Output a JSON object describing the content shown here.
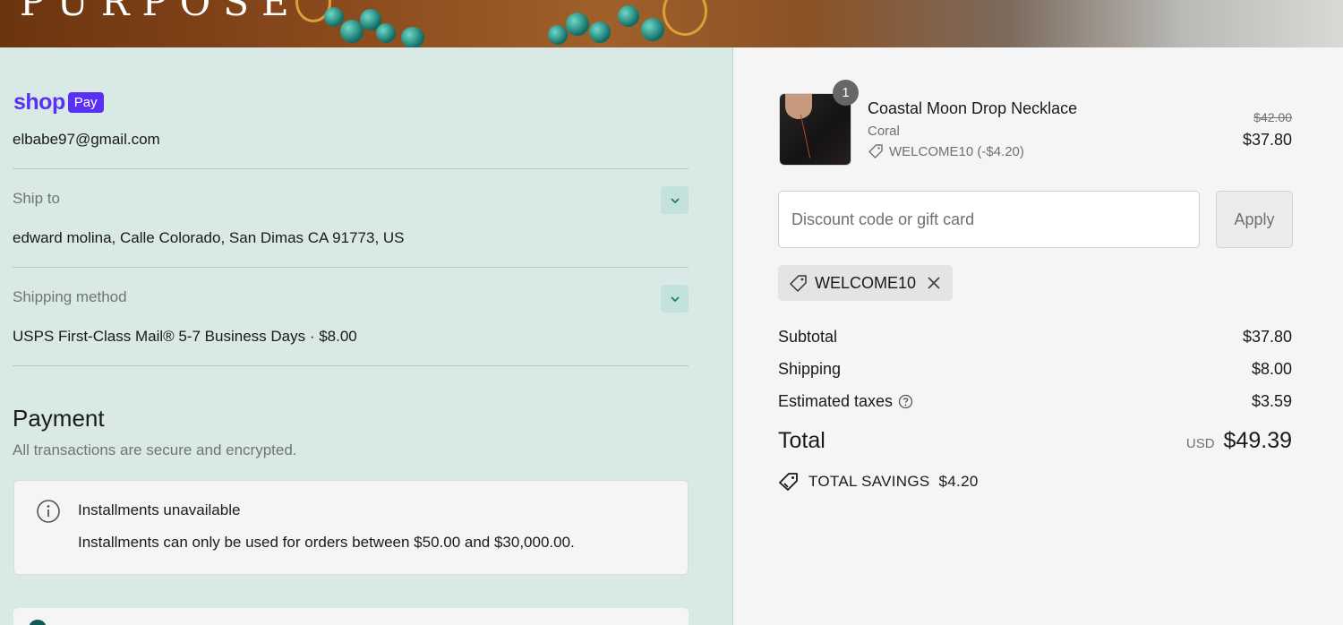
{
  "banner": {
    "brand_text": "PURPOSE"
  },
  "shop_pay": {
    "shop": "shop",
    "pay": "Pay"
  },
  "contact": {
    "email": "elbabe97@gmail.com"
  },
  "ship_to": {
    "label": "Ship to",
    "value": "edward molina, Calle Colorado, San Dimas CA 91773, US"
  },
  "shipping_method": {
    "label": "Shipping method",
    "value": "USPS First-Class Mail® 5-7 Business Days · $8.00"
  },
  "payment": {
    "title": "Payment",
    "subtitle": "All transactions are secure and encrypted.",
    "installments_title": "Installments unavailable",
    "installments_desc": "Installments can only be used for orders between $50.00 and $30,000.00."
  },
  "cart": {
    "item": {
      "quantity": "1",
      "name": "Coastal Moon Drop Necklace",
      "variant": "Coral",
      "discount": "WELCOME10 (-$4.20)",
      "price_original": "$42.00",
      "price_final": "$37.80"
    },
    "discount_placeholder": "Discount code or gift card",
    "apply_label": "Apply",
    "applied_code": "WELCOME10"
  },
  "summary": {
    "subtotal_label": "Subtotal",
    "subtotal": "$37.80",
    "shipping_label": "Shipping",
    "shipping": "$8.00",
    "taxes_label": "Estimated taxes",
    "taxes": "$3.59",
    "total_label": "Total",
    "currency": "USD",
    "total": "$49.39",
    "savings_label": "TOTAL SAVINGS",
    "savings": "$4.20"
  },
  "colors": {
    "shop_purple": "#5a31f4",
    "left_bg": "#d9e9e5",
    "right_bg": "#f5f5f5",
    "accent_teal": "#0f5c54"
  }
}
